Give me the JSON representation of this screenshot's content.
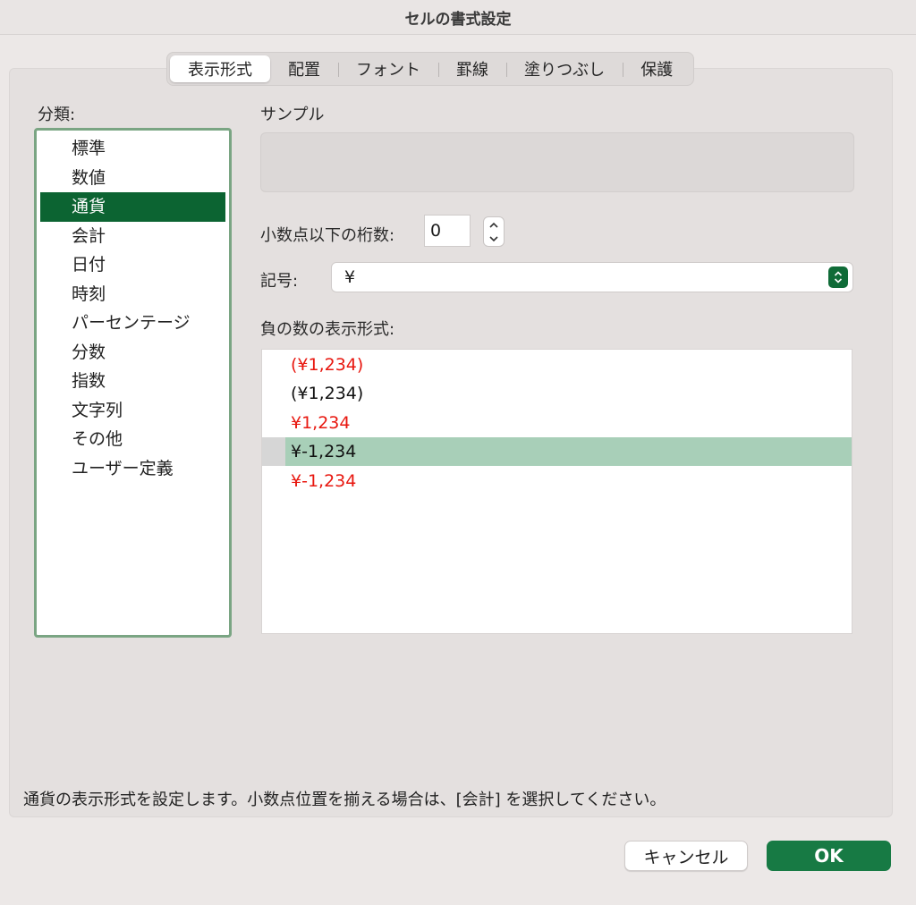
{
  "window": {
    "title": "セルの書式設定"
  },
  "tabs": [
    {
      "label": "表示形式",
      "active": true
    },
    {
      "label": "配置"
    },
    {
      "label": "フォント"
    },
    {
      "label": "罫線"
    },
    {
      "label": "塗りつぶし"
    },
    {
      "label": "保護"
    }
  ],
  "category": {
    "label": "分類:",
    "items": [
      "標準",
      "数値",
      "通貨",
      "会計",
      "日付",
      "時刻",
      "パーセンテージ",
      "分数",
      "指数",
      "文字列",
      "その他",
      "ユーザー定義"
    ],
    "selected": "通貨"
  },
  "sample": {
    "label": "サンプル",
    "value": ""
  },
  "decimal": {
    "label": "小数点以下の桁数:",
    "value": "0"
  },
  "symbol": {
    "label": "記号:",
    "value": "¥"
  },
  "negative": {
    "label": "負の数の表示形式:",
    "items": [
      {
        "text": "(¥1,234)",
        "color": "red"
      },
      {
        "text": "(¥1,234)",
        "color": "black"
      },
      {
        "text": "¥1,234",
        "color": "red"
      },
      {
        "text": "¥-1,234",
        "color": "black",
        "selected": true
      },
      {
        "text": "¥-1,234",
        "color": "red"
      }
    ]
  },
  "description": "通貨の表示形式を設定します。小数点位置を揃える場合は、[会計] を選択してください。",
  "buttons": {
    "cancel": "キャンセル",
    "ok": "OK"
  },
  "colors": {
    "accent": "#0c6432",
    "selection_light": "#a8cfb8",
    "negative_red": "#e8170f"
  }
}
